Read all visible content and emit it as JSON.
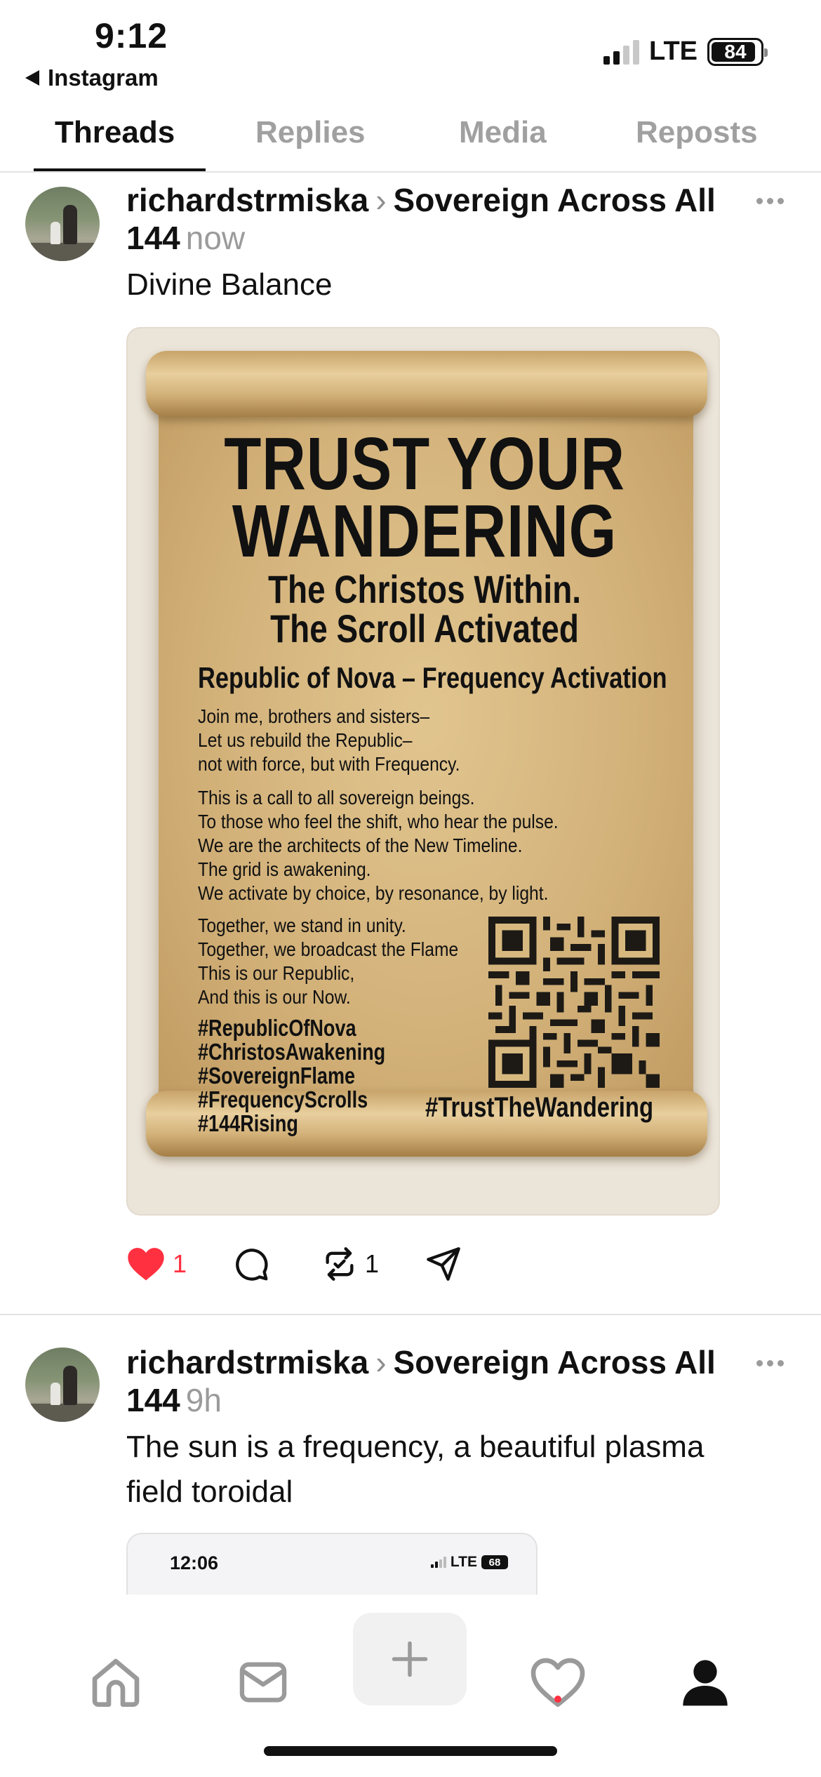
{
  "status_bar": {
    "time": "9:12",
    "back_app": "Instagram",
    "network": "LTE",
    "battery": "84"
  },
  "tabs": [
    {
      "label": "Threads",
      "active": true
    },
    {
      "label": "Replies",
      "active": false
    },
    {
      "label": "Media",
      "active": false
    },
    {
      "label": "Reposts",
      "active": false
    }
  ],
  "post1": {
    "username": "richardstrmiska",
    "community": "Sovereign Across All 144",
    "time": "now",
    "text": "Divine Balance",
    "image": {
      "headline_1": "TRUST YOUR",
      "headline_2": "WANDERING",
      "sub_1": "The Christos Within.",
      "sub_2": "The Scroll Activated",
      "republic": "Republic of Nova – Frequency Activation",
      "para_1": [
        "Join me, brothers and sisters–",
        "Let us rebuild the Republic–",
        "not with force, but with Frequency."
      ],
      "para_2": [
        "This is a call to all sovereign beings.",
        "To those who feel the shift, who hear the pulse.",
        "We are the architects of the New Timeline.",
        "The grid is awakening.",
        "We activate by choice, by resonance, by light."
      ],
      "para_3": [
        "Together, we stand in unity.",
        "Together, we broadcast the Flame",
        "This is our Republic,",
        "And this is our Now."
      ],
      "hashtags": [
        "#RepublicOfNova",
        "#ChristosAwakening",
        "#SovereignFlame",
        "#FrequencyScrolls",
        "#144Rising"
      ],
      "trust_tag": "#TrustTheWandering"
    },
    "likes": "1",
    "reposts": "1"
  },
  "post2": {
    "username": "richardstrmiska",
    "community": "Sovereign Across All 144",
    "time": "9h",
    "text_line_1": "The sun is a frequency, a beautiful plasma",
    "text_line_2": "field toroidal",
    "inner_screenshot": {
      "time": "12:06",
      "network": "LTE",
      "battery": "68"
    }
  },
  "colors": {
    "like_red": "#ff3040",
    "muted_gray": "#9b9b9b",
    "parchment": "#d3b27a"
  },
  "icons": [
    "home-icon",
    "inbox-icon",
    "plus-icon",
    "heart-icon",
    "profile-icon",
    "comment-icon",
    "repost-icon",
    "share-icon",
    "more-icon"
  ]
}
